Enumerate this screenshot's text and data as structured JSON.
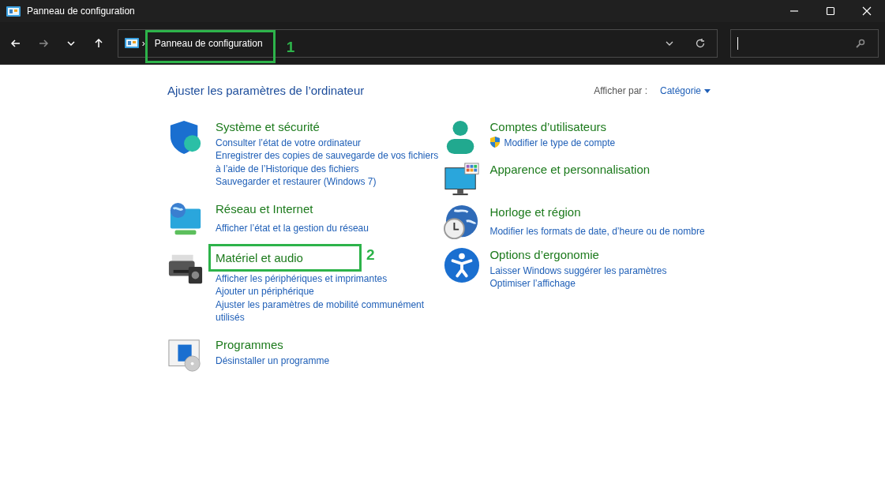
{
  "window": {
    "title": "Panneau de configuration"
  },
  "address_bar": {
    "separator": "›",
    "path": "Panneau de configuration",
    "annotation": "1"
  },
  "heading": "Ajuster les paramètres de l’ordinateur",
  "view_by": {
    "label": "Afficher par :",
    "value": "Catégorie"
  },
  "columns": [
    [
      {
        "title": "Système et sécurité",
        "links": [
          {
            "text": "Consulter l’état de votre ordinateur",
            "shield": false
          },
          {
            "text": "Enregistrer des copies de sauvegarde de vos fichiers à l’aide de l’Historique des fichiers",
            "shield": false
          },
          {
            "text": "Sauvegarder et restaurer (Windows 7)",
            "shield": false
          }
        ]
      },
      {
        "title": "Réseau et Internet",
        "links": [
          {
            "text": "Afficher l’état et la gestion du réseau",
            "shield": false
          }
        ]
      },
      {
        "title": "Matériel et audio",
        "annotation": "2",
        "links": [
          {
            "text": "Afficher les périphériques et imprimantes",
            "shield": false
          },
          {
            "text": "Ajouter un périphérique",
            "shield": false
          },
          {
            "text": "Ajuster les paramètres de mobilité communément utilisés",
            "shield": false
          }
        ]
      },
      {
        "title": "Programmes",
        "links": [
          {
            "text": "Désinstaller un programme",
            "shield": false
          }
        ]
      }
    ],
    [
      {
        "title": "Comptes d’utilisateurs",
        "links": [
          {
            "text": "Modifier le type de compte",
            "shield": true
          }
        ]
      },
      {
        "title": "Apparence et personnalisation"
      },
      {
        "title": "Horloge et région",
        "links": [
          {
            "text": "Modifier les formats de date, d’heure ou de nombre",
            "shield": false
          }
        ]
      },
      {
        "title": "Options d’ergonomie",
        "links": [
          {
            "text": "Laisser Windows suggérer les paramètres",
            "shield": false
          },
          {
            "text": "Optimiser l’affichage",
            "shield": false
          }
        ]
      }
    ]
  ]
}
